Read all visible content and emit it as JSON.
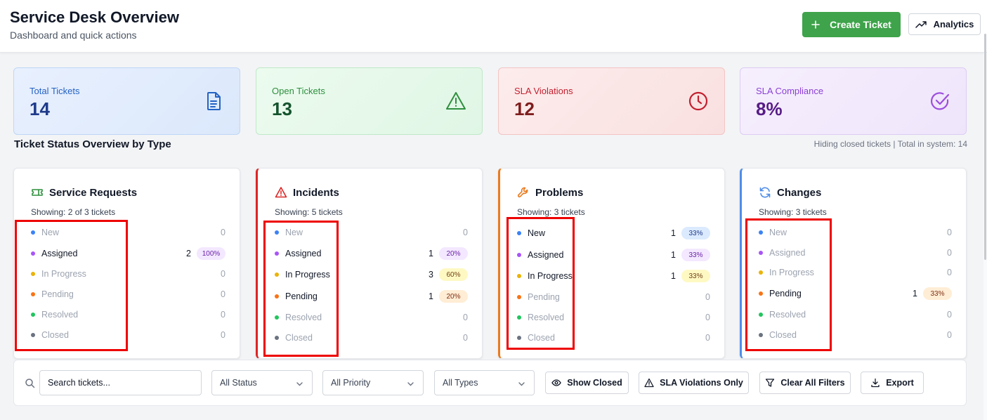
{
  "header": {
    "title": "Service Desk Overview",
    "subtitle": "Dashboard and quick actions",
    "create_label": "Create Ticket",
    "analytics_label": "Analytics"
  },
  "stats": [
    {
      "label": "Total Tickets",
      "value": "14",
      "icon": "document-icon"
    },
    {
      "label": "Open Tickets",
      "value": "13",
      "icon": "warning-triangle-icon"
    },
    {
      "label": "SLA Violations",
      "value": "12",
      "icon": "clock-icon"
    },
    {
      "label": "SLA Compliance",
      "value": "8%",
      "icon": "check-circle-icon"
    }
  ],
  "overview": {
    "title": "Ticket Status Overview by Type",
    "note": "Hiding closed tickets | Total in system: 14"
  },
  "cards": [
    {
      "title": "Service Requests",
      "icon": "ticket-icon",
      "subtitle": "Showing: 2 of 3 tickets",
      "rows": [
        {
          "label": "New",
          "count": "0",
          "pct": ""
        },
        {
          "label": "Assigned",
          "count": "2",
          "pct": "100%"
        },
        {
          "label": "In Progress",
          "count": "0",
          "pct": ""
        },
        {
          "label": "Pending",
          "count": "0",
          "pct": ""
        },
        {
          "label": "Resolved",
          "count": "0",
          "pct": ""
        },
        {
          "label": "Closed",
          "count": "0",
          "pct": ""
        }
      ]
    },
    {
      "title": "Incidents",
      "icon": "alert-triangle-icon",
      "subtitle": "Showing: 5 tickets",
      "rows": [
        {
          "label": "New",
          "count": "0",
          "pct": ""
        },
        {
          "label": "Assigned",
          "count": "1",
          "pct": "20%"
        },
        {
          "label": "In Progress",
          "count": "3",
          "pct": "60%"
        },
        {
          "label": "Pending",
          "count": "1",
          "pct": "20%"
        },
        {
          "label": "Resolved",
          "count": "0",
          "pct": ""
        },
        {
          "label": "Closed",
          "count": "0",
          "pct": ""
        }
      ]
    },
    {
      "title": "Problems",
      "icon": "wrench-icon",
      "subtitle": "Showing: 3 tickets",
      "rows": [
        {
          "label": "New",
          "count": "1",
          "pct": "33%"
        },
        {
          "label": "Assigned",
          "count": "1",
          "pct": "33%"
        },
        {
          "label": "In Progress",
          "count": "1",
          "pct": "33%"
        },
        {
          "label": "Pending",
          "count": "0",
          "pct": ""
        },
        {
          "label": "Resolved",
          "count": "0",
          "pct": ""
        },
        {
          "label": "Closed",
          "count": "0",
          "pct": ""
        }
      ]
    },
    {
      "title": "Changes",
      "icon": "refresh-icon",
      "subtitle": "Showing: 3 tickets",
      "rows": [
        {
          "label": "New",
          "count": "0",
          "pct": ""
        },
        {
          "label": "Assigned",
          "count": "0",
          "pct": ""
        },
        {
          "label": "In Progress",
          "count": "0",
          "pct": ""
        },
        {
          "label": "Pending",
          "count": "1",
          "pct": "33%"
        },
        {
          "label": "Resolved",
          "count": "0",
          "pct": ""
        },
        {
          "label": "Closed",
          "count": "0",
          "pct": ""
        }
      ]
    }
  ],
  "status_colors": {
    "New": "#3b82f6",
    "Assigned": "#a855f7",
    "In Progress": "#eab308",
    "Pending": "#f97316",
    "Resolved": "#22c55e",
    "Closed": "#6b7280"
  },
  "badge_colors": {
    "New": {
      "bg": "#dbeafe",
      "fg": "#1e3a8a"
    },
    "Assigned": {
      "bg": "#f3e8ff",
      "fg": "#6b21a8"
    },
    "In Progress": {
      "bg": "#fef9c3",
      "fg": "#713f12"
    },
    "Pending": {
      "bg": "#ffedd5",
      "fg": "#7c2d12"
    }
  },
  "filters": {
    "search_placeholder": "Search tickets...",
    "status": "All Status",
    "priority": "All Priority",
    "types": "All Types",
    "show_closed": "Show Closed",
    "sla_only": "SLA Violations Only",
    "clear": "Clear All Filters",
    "export": "Export"
  }
}
